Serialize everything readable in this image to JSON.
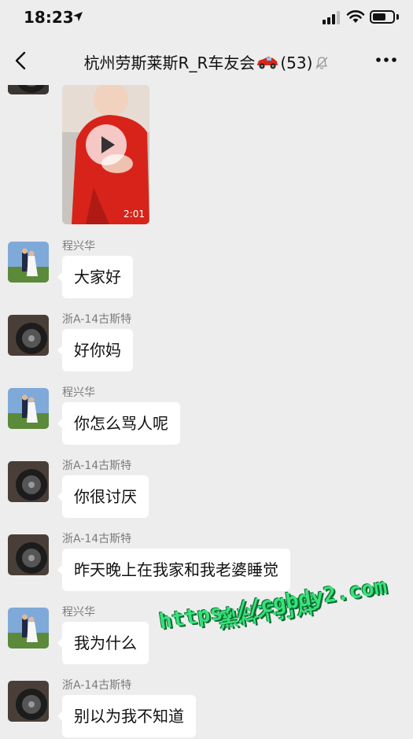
{
  "status_bar": {
    "time": "18:23"
  },
  "header": {
    "title": "杭州劳斯莱斯R_R车友会",
    "member_count": "(53)"
  },
  "video": {
    "duration": "2:01"
  },
  "messages": [
    {
      "sender": "程兴华",
      "text": "大家好",
      "avatar": "man-with-bride-photo"
    },
    {
      "sender": "浙A-14古斯特",
      "text": "好你妈",
      "avatar": "car-wheel-photo"
    },
    {
      "sender": "程兴华",
      "text": "你怎么骂人呢",
      "avatar": "man-with-bride-photo"
    },
    {
      "sender": "浙A-14古斯特",
      "text": "你很讨厌",
      "avatar": "car-wheel-photo"
    },
    {
      "sender": "浙A-14古斯特",
      "text": "昨天晚上在我家和我老婆睡觉",
      "avatar": "car-wheel-photo"
    },
    {
      "sender": "程兴华",
      "text": "我为什么",
      "avatar": "man-with-bride-photo"
    },
    {
      "sender": "浙A-14古斯特",
      "text": "别以为我不知道",
      "avatar": "car-wheel-photo"
    }
  ],
  "watermark": {
    "line1": "黑料不打烊",
    "line2": "https://cgbdy2.com"
  },
  "colors": {
    "background": "#ededed",
    "bubble": "#ffffff",
    "watermark": "#39e27a"
  }
}
